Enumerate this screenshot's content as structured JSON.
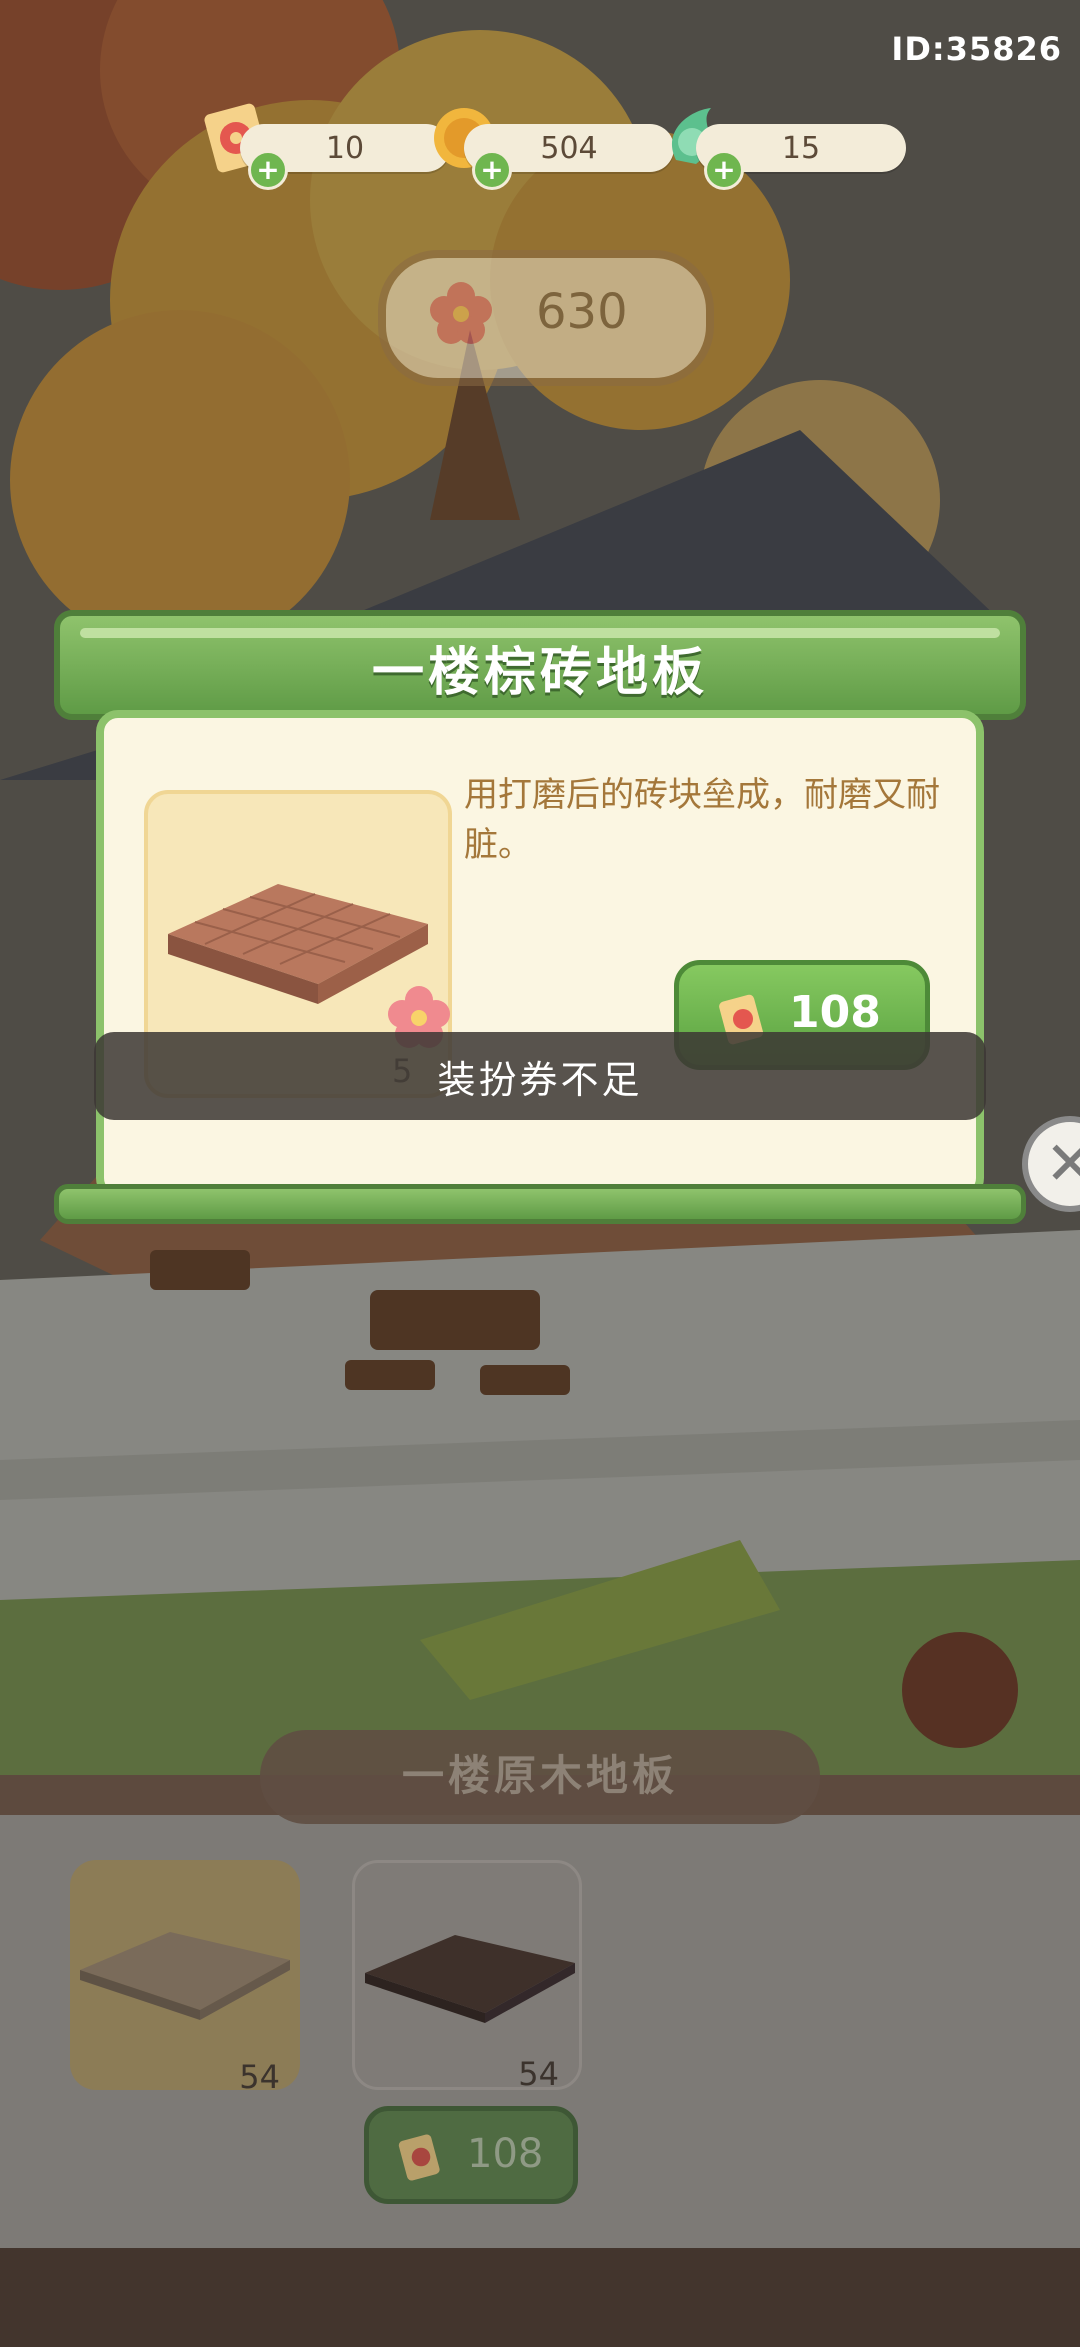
{
  "player": {
    "id": "ID:35826"
  },
  "currencies": [
    {
      "name": "dress-ticket",
      "value": "10",
      "color": "#e4574f"
    },
    {
      "name": "coin",
      "value": "504",
      "color": "#f1b63d"
    },
    {
      "name": "leaf-gem",
      "value": "15",
      "color": "#5cc08e"
    }
  ],
  "scene": {
    "flower_counter": "630"
  },
  "modal": {
    "title": "一楼棕砖地板",
    "description": "用打磨后的砖块垒成，耐磨又耐脏。",
    "flower_cost": "5",
    "price": "108"
  },
  "toast": {
    "message": "装扮券不足"
  },
  "bottom_panel": {
    "title": "一楼原木地板",
    "items": [
      {
        "name": "light-wood-floor",
        "count": "54",
        "selected": true
      },
      {
        "name": "dark-wood-floor",
        "count": "54",
        "selected": false
      }
    ],
    "price": "108"
  }
}
